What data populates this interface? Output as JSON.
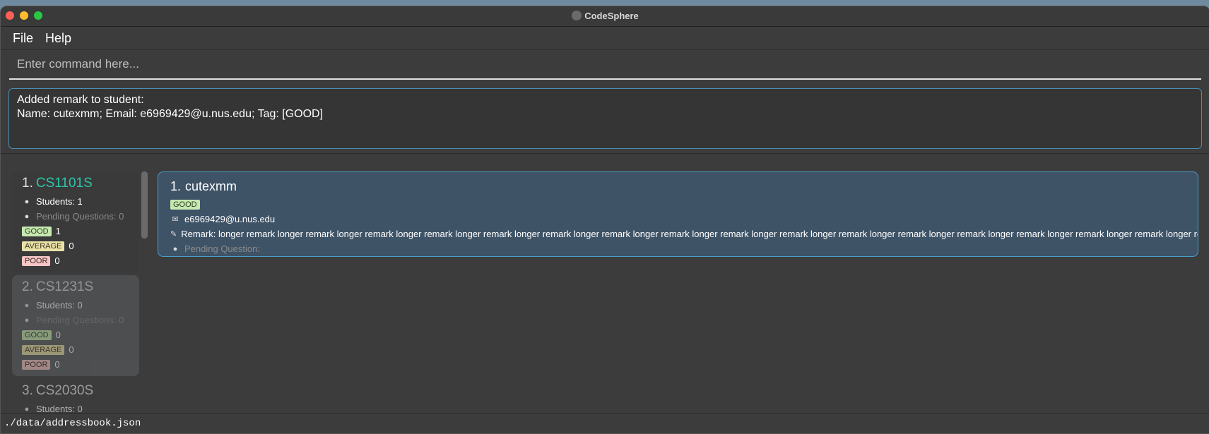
{
  "window": {
    "title": "CodeSphere"
  },
  "menu": {
    "file": "File",
    "help": "Help"
  },
  "command": {
    "placeholder": "Enter command here..."
  },
  "result": {
    "line1": "Added remark to student:",
    "line2": "Name: cutexmm; Email: e6969429@u.nus.edu; Tag: [GOOD]"
  },
  "courses": [
    {
      "index": "1.",
      "name": "CS1101S",
      "students": "Students: 1",
      "pending": "Pending Questions: 0",
      "good_label": "GOOD",
      "good": "1",
      "average_label": "AVERAGE",
      "average": "0",
      "poor_label": "POOR",
      "poor": "0"
    },
    {
      "index": "2.",
      "name": "CS1231S",
      "students": "Students: 0",
      "pending": "Pending Questions: 0",
      "good_label": "GOOD",
      "good": "0",
      "average_label": "AVERAGE",
      "average": "0",
      "poor_label": "POOR",
      "poor": "0"
    },
    {
      "index": "3.",
      "name": "CS2030S",
      "students": "Students: 0"
    }
  ],
  "student": {
    "index": "1.",
    "name": "cutexmm",
    "tag": "GOOD",
    "email": "e6969429@u.nus.edu",
    "remark": "Remark: longer remark longer remark longer remark longer remark longer remark longer remark longer remark longer remark longer remark longer remark longer remark longer remark longer remark longer remark longer remark longer remark longer remark longer remar",
    "pending": "Pending Question:"
  },
  "status": {
    "path": "./data/addressbook.json"
  },
  "colors": {
    "accent": "#2ec4a8",
    "card_border": "#4a9ec8",
    "good": "#c6e9b0",
    "average": "#ebe2a8",
    "poor": "#f5c6c4"
  },
  "icons": {
    "person": "person-icon",
    "chat": "chat-bubble-icon",
    "mail": "mail-icon",
    "note": "note-icon"
  }
}
